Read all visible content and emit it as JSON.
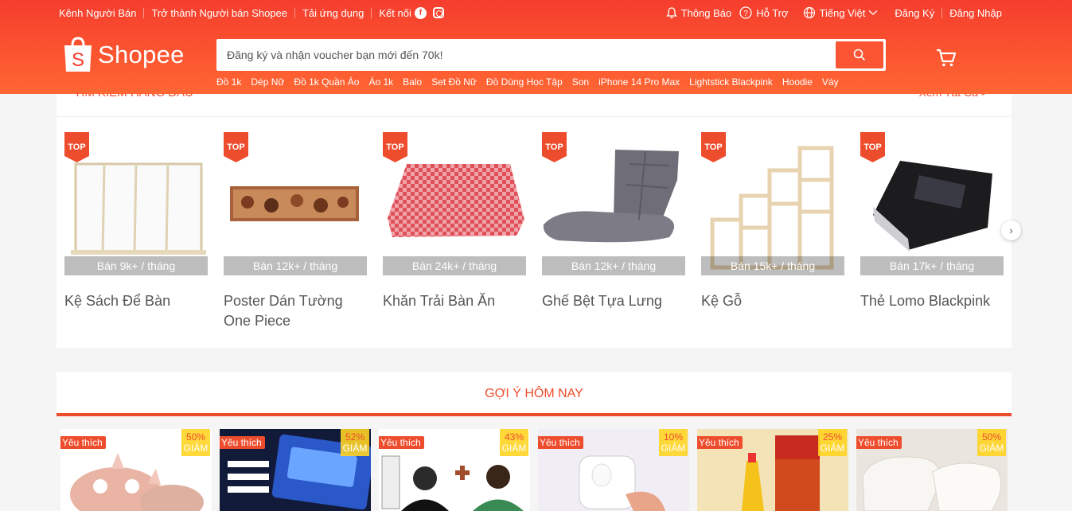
{
  "header": {
    "topbar_left": [
      "Kênh Người Bán",
      "Trở thành Người bán Shopee",
      "Tải ứng dụng",
      "Kết nối"
    ],
    "notifications": "Thông Báo",
    "help": "Hỗ Trợ",
    "language": "Tiếng Việt",
    "register": "Đăng Ký",
    "login": "Đăng Nhập",
    "logo_text": "Shopee",
    "search_placeholder": "Đăng ký và nhận voucher bạn mới đến 70k!",
    "suggestions": [
      "Đồ 1k",
      "Dép Nữ",
      "Đồ 1k Quần Áo",
      "Áo 1k",
      "Balo",
      "Set Đồ Nữ",
      "Đồ Dùng Học Tập",
      "Son",
      "iPhone 14 Pro Max",
      "Lightstick Blackpink",
      "Hoodie",
      "Váy"
    ]
  },
  "top_search": {
    "title": "Tìm kiếm hàng đầu",
    "see_all": "Xem Tất Cả >",
    "badge": "TOP",
    "items": [
      {
        "name": "Kệ Sách Để Bàn",
        "sold": "Bán 9k+ / tháng"
      },
      {
        "name": "Poster Dán Tường One Piece",
        "sold": "Bán 12k+ / tháng"
      },
      {
        "name": "Khăn Trải Bàn Ăn",
        "sold": "Bán 24k+ / tháng"
      },
      {
        "name": "Ghế Bệt Tựa Lưng",
        "sold": "Bán 12k+ / tháng"
      },
      {
        "name": "Kệ Gỗ",
        "sold": "Bán 15k+ / tháng"
      },
      {
        "name": "Thẻ Lomo Blackpink",
        "sold": "Bán 17k+ / tháng"
      }
    ]
  },
  "daily": {
    "title": "Gợi ý hôm nay",
    "fav_label": "Yêu thích",
    "discount_label": "GIẢM",
    "products": [
      {
        "discount": "50%"
      },
      {
        "discount": "52%"
      },
      {
        "discount": "43%"
      },
      {
        "discount": "10%"
      },
      {
        "discount": "25%"
      },
      {
        "discount": "50%"
      }
    ]
  },
  "colors": {
    "brand": "#ee4d2d",
    "header_from": "#f53d2d",
    "header_to": "#ff6633"
  }
}
